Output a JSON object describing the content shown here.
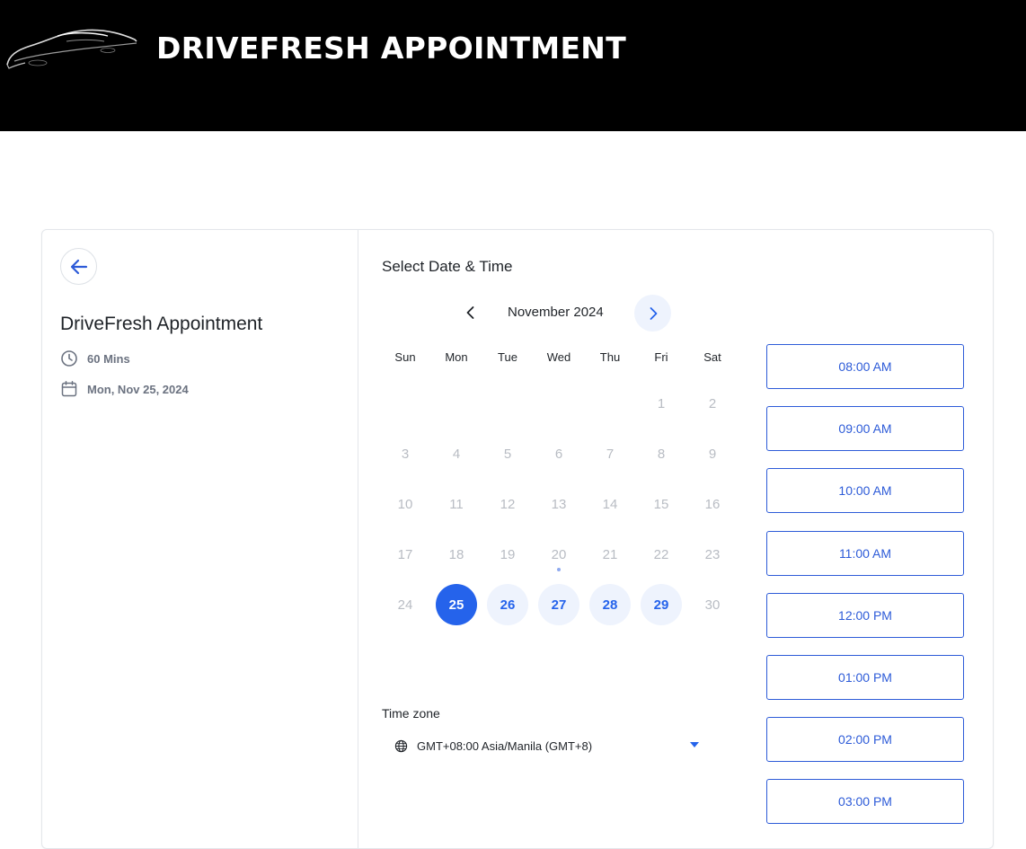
{
  "header": {
    "brand_title": "DRIVEFRESH APPOINTMENT",
    "logo_icon": "car-silhouette-icon"
  },
  "event": {
    "title": "DriveFresh Appointment",
    "duration": "60 Mins",
    "selected_date": "Mon, Nov 25, 2024"
  },
  "calendar": {
    "section_title": "Select Date & Time",
    "month_label": "November 2024",
    "weekdays": [
      "Sun",
      "Mon",
      "Tue",
      "Wed",
      "Thu",
      "Fri",
      "Sat"
    ],
    "days": [
      {
        "label": "1",
        "state": "disabled"
      },
      {
        "label": "2",
        "state": "disabled"
      },
      {
        "label": "3",
        "state": "disabled"
      },
      {
        "label": "4",
        "state": "disabled"
      },
      {
        "label": "5",
        "state": "disabled"
      },
      {
        "label": "6",
        "state": "disabled"
      },
      {
        "label": "7",
        "state": "disabled"
      },
      {
        "label": "8",
        "state": "disabled"
      },
      {
        "label": "9",
        "state": "disabled"
      },
      {
        "label": "10",
        "state": "disabled"
      },
      {
        "label": "11",
        "state": "disabled"
      },
      {
        "label": "12",
        "state": "disabled"
      },
      {
        "label": "13",
        "state": "disabled"
      },
      {
        "label": "14",
        "state": "disabled"
      },
      {
        "label": "15",
        "state": "disabled"
      },
      {
        "label": "16",
        "state": "disabled"
      },
      {
        "label": "17",
        "state": "disabled"
      },
      {
        "label": "18",
        "state": "disabled"
      },
      {
        "label": "19",
        "state": "disabled"
      },
      {
        "label": "20",
        "state": "today"
      },
      {
        "label": "21",
        "state": "disabled"
      },
      {
        "label": "22",
        "state": "disabled"
      },
      {
        "label": "23",
        "state": "disabled"
      },
      {
        "label": "24",
        "state": "disabled"
      },
      {
        "label": "25",
        "state": "selected"
      },
      {
        "label": "26",
        "state": "available"
      },
      {
        "label": "27",
        "state": "available"
      },
      {
        "label": "28",
        "state": "available"
      },
      {
        "label": "29",
        "state": "available"
      },
      {
        "label": "30",
        "state": "disabled"
      }
    ]
  },
  "timezone": {
    "label": "Time zone",
    "value": "GMT+08:00 Asia/Manila (GMT+8)"
  },
  "time_slots": [
    "08:00 AM",
    "09:00 AM",
    "10:00 AM",
    "11:00 AM",
    "12:00 PM",
    "01:00 PM",
    "02:00 PM",
    "03:00 PM"
  ],
  "colors": {
    "accent": "#2563eb",
    "slot_border": "#2d5bd8",
    "available_bg": "#eef3fd",
    "header_bg": "#000000"
  }
}
